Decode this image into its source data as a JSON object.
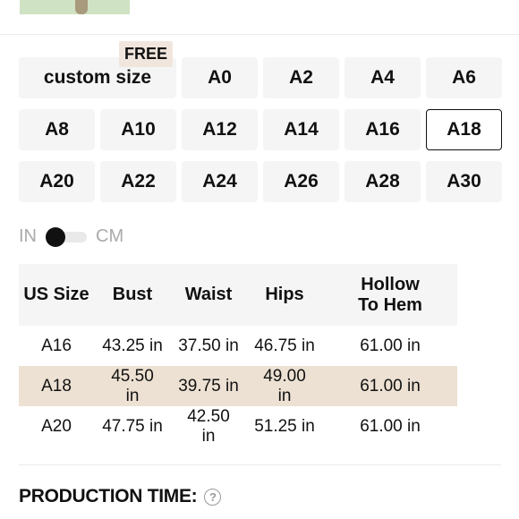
{
  "size_options": {
    "free_badge": "FREE",
    "rows": [
      [
        "custom size",
        "A0",
        "A2",
        "A4",
        "A6"
      ],
      [
        "A8",
        "A10",
        "A12",
        "A14",
        "A16",
        "A18"
      ],
      [
        "A20",
        "A22",
        "A24",
        "A26",
        "A28",
        "A30"
      ]
    ],
    "selected": "A18"
  },
  "unit_toggle": {
    "left_label": "IN",
    "right_label": "CM"
  },
  "size_chart": {
    "headers": [
      "US Size",
      "Bust",
      "Waist",
      "Hips",
      "Hollow To Hem"
    ],
    "rows": [
      [
        "A16",
        "43.25 in",
        "37.50 in",
        "46.75 in",
        "61.00 in"
      ],
      [
        "A18",
        "45.50 in",
        "39.75 in",
        "49.00 in",
        "61.00 in"
      ],
      [
        "A20",
        "47.75 in",
        "42.50 in",
        "51.25 in",
        "61.00 in"
      ]
    ],
    "highlight_row": 1
  },
  "production_time": {
    "label": "PRODUCTION TIME:",
    "help_icon": "question-circle-icon"
  },
  "colors": {
    "highlight": "#ede1d3",
    "badge": "#f1e6dd",
    "cell_bg": "#f5f5f5"
  }
}
